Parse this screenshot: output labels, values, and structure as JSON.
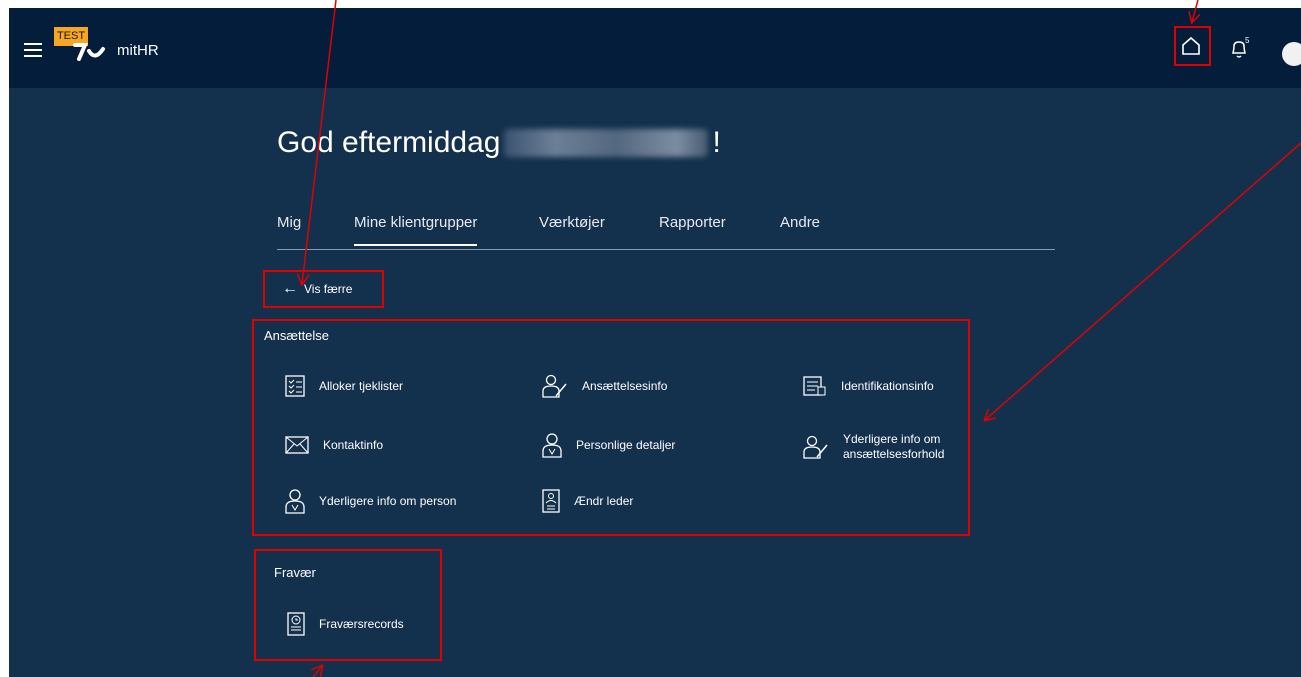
{
  "app": {
    "badge": "TEST",
    "name": "mitHR",
    "notification_count": "5"
  },
  "greeting": {
    "prefix": "God eftermiddag",
    "suffix": "!"
  },
  "tabs": [
    {
      "label": "Mig"
    },
    {
      "label": "Mine klientgrupper"
    },
    {
      "label": "Værktøjer"
    },
    {
      "label": "Rapporter"
    },
    {
      "label": "Andre"
    }
  ],
  "show_less": {
    "label": "Vis færre"
  },
  "sections": {
    "employment": {
      "title": "Ansættelse",
      "items": [
        {
          "label": "Alloker tjeklister",
          "icon": "checklist-icon"
        },
        {
          "label": "Ansættelsesinfo",
          "icon": "person-edit-icon"
        },
        {
          "label": "Identifikationsinfo",
          "icon": "id-document-icon"
        },
        {
          "label": "Kontaktinfo",
          "icon": "envelope-icon"
        },
        {
          "label": "Personlige detaljer",
          "icon": "person-icon"
        },
        {
          "label": "Yderligere info om ansættelsesforhold",
          "icon": "person-edit-icon"
        },
        {
          "label": "Yderligere info om person",
          "icon": "person-icon"
        },
        {
          "label": "Ændr leder",
          "icon": "person-badge-icon"
        }
      ]
    },
    "absence": {
      "title": "Fravær",
      "items": [
        {
          "label": "Fraværsrecords",
          "icon": "clock-badge-icon"
        }
      ]
    }
  },
  "colors": {
    "header_bg": "#031d3a",
    "page_bg": "#13304c",
    "annotation": "#e00000",
    "badge": "#f5a623"
  }
}
